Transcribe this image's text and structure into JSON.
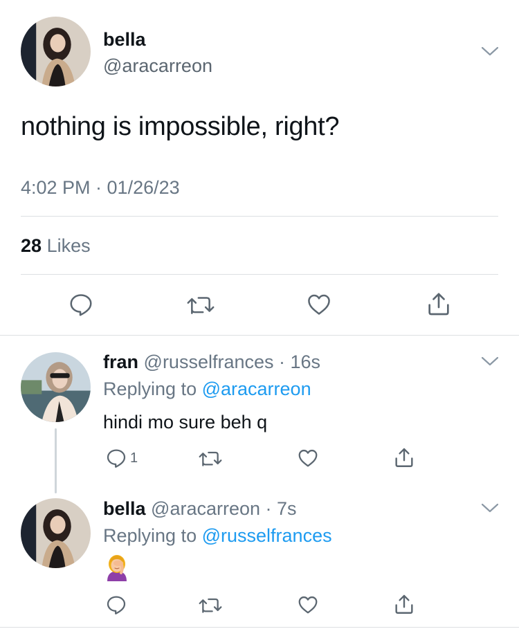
{
  "main_tweet": {
    "name": "bella",
    "handle": "@aracarreon",
    "text": "nothing is impossible, right?",
    "timestamp": "4:02 PM · 01/26/23",
    "likes_count": "28",
    "likes_label": "Likes",
    "actions": [
      "reply-icon",
      "retweet-icon",
      "like-icon",
      "share-icon"
    ]
  },
  "replies": [
    {
      "name": "fran",
      "handle": "@russelfrances",
      "time": "· 16s",
      "replying_prefix": "Replying to",
      "replying_to": "@aracarreon",
      "text": "hindi mo sure beh q",
      "reply_count": "1"
    },
    {
      "name": "bella",
      "handle": "@aracarreon",
      "time": "· 7s",
      "replying_prefix": "Replying to",
      "replying_to": "@russelfrances",
      "text": "🤦‍♀️",
      "reply_count": ""
    }
  ],
  "colors": {
    "link": "#1d9bf0",
    "secondary_text": "#687684",
    "divider": "#dcdfe2"
  }
}
